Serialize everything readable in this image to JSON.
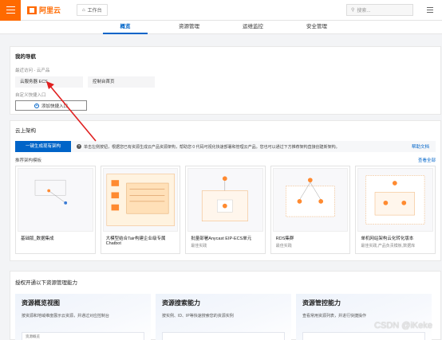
{
  "header": {
    "logo_text": "阿里云",
    "workbench_label": "工作台",
    "search_placeholder": "搜索..."
  },
  "tabs": [
    {
      "label": "概览",
      "active": true
    },
    {
      "label": "资源管理",
      "active": false
    },
    {
      "label": "运维监控",
      "active": false
    },
    {
      "label": "安全管理",
      "active": false
    }
  ],
  "nav": {
    "title": "我的导航",
    "recent_label": "最近访问 - 云产品",
    "recent_items": [
      "云服务器 ECS",
      "控制台首页"
    ],
    "custom_label": "自定义快捷入口",
    "add_button": "添加快捷入口"
  },
  "arch": {
    "title": "云上架构",
    "generate_button": "一键生成现有架构",
    "description": "单击左侧按钮，根据您已有资源生成云产品资源架构，帮助您 0 代码可视化快速部署和管理云产品。您也可以通过下方推荐架构直接创建新架构。",
    "help_doc": "帮助文档",
    "templates_label": "推荐架构模板",
    "view_all": "查看全部",
    "templates": [
      {
        "name": "基础版_数据集成",
        "tag": ""
      },
      {
        "name": "大模型结合Tair构建企业级专属Chatbot",
        "tag": ""
      },
      {
        "name": "批量部署Anycast EIP-ECS单元",
        "tag": "最佳实践"
      },
      {
        "name": "RDS集群",
        "tag": "最佳实践"
      },
      {
        "name": "单机网站架构云化转化版本",
        "tag": "最佳实践,产品负责模板,数据库"
      }
    ]
  },
  "auth": {
    "title": "授权开通以下资源管理能力",
    "capabilities": [
      {
        "title": "资源概览视图",
        "desc": "按资源和地域维度展示云资源，并通过对应控制台",
        "mini": "资源概览"
      },
      {
        "title": "资源搜索能力",
        "desc": "按实例、ID、IP等快速搜索您的资源实例",
        "mini": ""
      },
      {
        "title": "资源管控能力",
        "desc": "查看常用资源列表，并进行快捷操作",
        "mini": ""
      }
    ]
  },
  "watermark": "CSDN @iKeke",
  "colors": {
    "brand": "#ff6a00",
    "primary": "#0064c8",
    "arrow": "#e02020"
  }
}
